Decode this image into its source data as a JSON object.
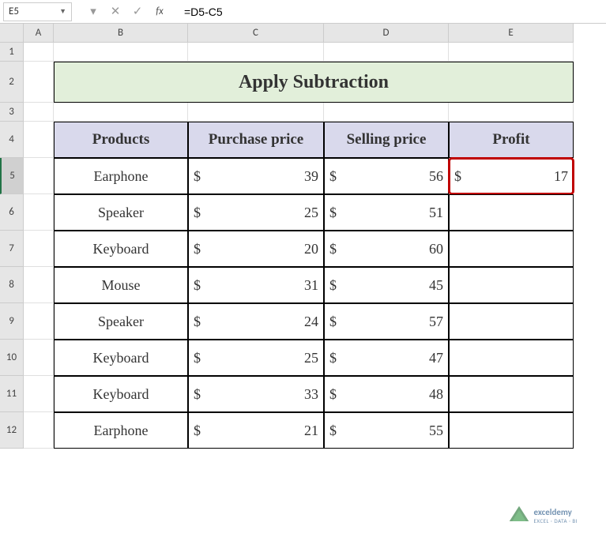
{
  "formula_bar": {
    "cell_ref": "E5",
    "formula": "=D5-C5"
  },
  "columns": [
    "A",
    "B",
    "C",
    "D",
    "E"
  ],
  "col_widths": {
    "A": 38,
    "B": 170,
    "C": 172,
    "D": 158,
    "E": 158
  },
  "rows": [
    1,
    2,
    3,
    4,
    5,
    6,
    7,
    8,
    9,
    10,
    11,
    12
  ],
  "row_heights": {
    "1": 24,
    "2": 52,
    "3": 24,
    "default": 46
  },
  "title": "Apply Subtraction",
  "headers": {
    "B": "Products",
    "C": "Purchase price",
    "D": "Selling price",
    "E": "Profit"
  },
  "chart_data": {
    "type": "table",
    "columns": [
      "Products",
      "Purchase price",
      "Selling price",
      "Profit"
    ],
    "rows": [
      {
        "product": "Earphone",
        "purchase": 39,
        "selling": 56,
        "profit": 17
      },
      {
        "product": "Speaker",
        "purchase": 25,
        "selling": 51,
        "profit": null
      },
      {
        "product": "Keyboard",
        "purchase": 20,
        "selling": 60,
        "profit": null
      },
      {
        "product": "Mouse",
        "purchase": 31,
        "selling": 45,
        "profit": null
      },
      {
        "product": "Speaker",
        "purchase": 24,
        "selling": 57,
        "profit": null
      },
      {
        "product": "Keyboard",
        "purchase": 25,
        "selling": 47,
        "profit": null
      },
      {
        "product": "Keyboard",
        "purchase": 33,
        "selling": 48,
        "profit": null
      },
      {
        "product": "Earphone",
        "purchase": 21,
        "selling": 55,
        "profit": null
      }
    ]
  },
  "selected": {
    "row": 5,
    "col": "E"
  },
  "watermark": {
    "brand": "exceldemy",
    "tagline": "EXCEL · DATA · BI"
  }
}
